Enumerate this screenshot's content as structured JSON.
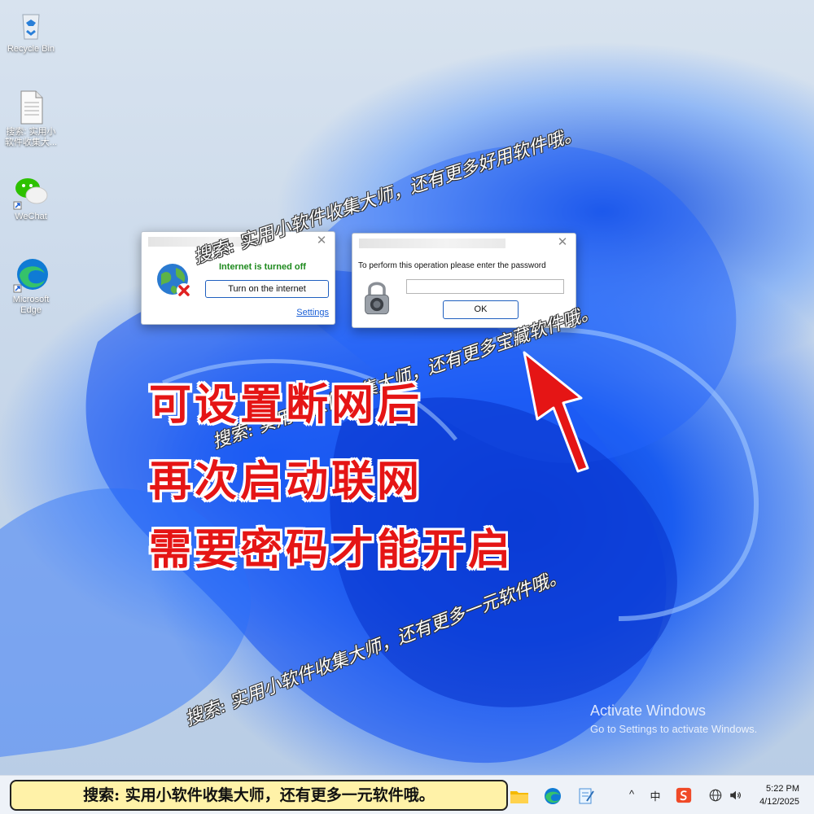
{
  "desktop": {
    "icons": [
      {
        "label": "Recycle Bin"
      },
      {
        "label": "搜索: 实用小软件收集大..."
      },
      {
        "label": "WeChat"
      },
      {
        "label": "Microsoft Edge"
      }
    ]
  },
  "internet_dialog": {
    "status_text": "Internet is turned off",
    "turn_on_button": "Turn on the internet",
    "settings_link": "Settings"
  },
  "password_dialog": {
    "prompt": "To perform this operation please enter the password",
    "password_value": "",
    "ok_button": "OK"
  },
  "watermarks": [
    "搜索: 实用小软件收集大师，还有更多好用软件哦。",
    "搜索: 实用小软件收集大师，还有更多宝藏软件哦。",
    "搜索: 实用小软件收集大师，还有更多一元软件哦。"
  ],
  "overlay_lines": [
    "可设置断网后",
    "再次启动联网",
    "需要密码才能开启"
  ],
  "activation": {
    "title": "Activate Windows",
    "subtitle": "Go to Settings to activate Windows."
  },
  "taskbar": {
    "banner": "搜索: 实用小软件收集大师，还有更多一元软件哦。",
    "tray_ime": "中",
    "clock_time": "5:22 PM",
    "clock_date": "4/12/2025"
  },
  "colors": {
    "accent_red": "#e51515",
    "status_green": "#1e8a1e",
    "link_blue": "#1a5fd6"
  }
}
